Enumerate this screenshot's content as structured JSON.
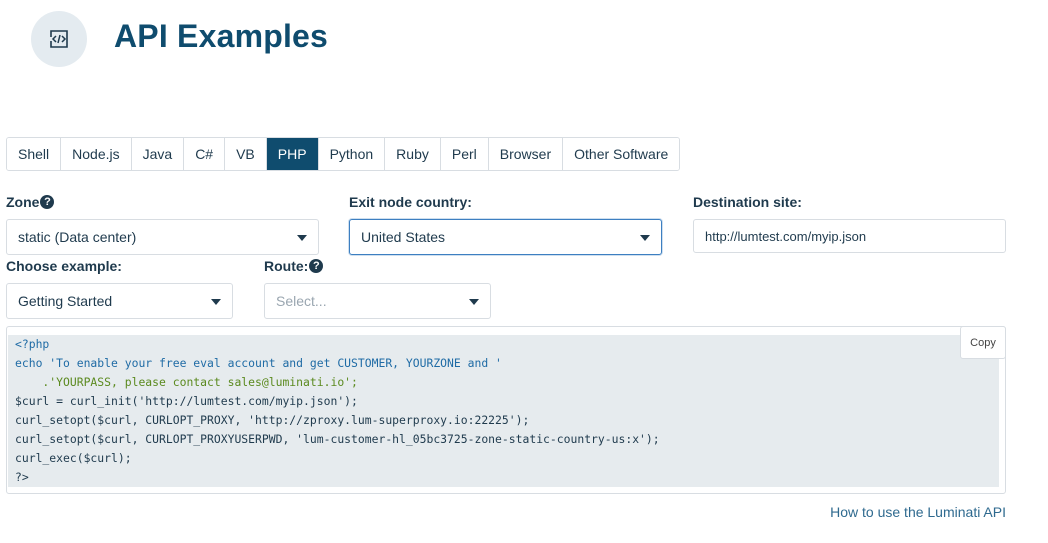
{
  "header": {
    "title": "API Examples",
    "icon": "code-tag-icon"
  },
  "tabs": [
    {
      "label": "Shell",
      "active": false
    },
    {
      "label": "Node.js",
      "active": false
    },
    {
      "label": "Java",
      "active": false
    },
    {
      "label": "C#",
      "active": false
    },
    {
      "label": "VB",
      "active": false
    },
    {
      "label": "PHP",
      "active": true
    },
    {
      "label": "Python",
      "active": false
    },
    {
      "label": "Ruby",
      "active": false
    },
    {
      "label": "Perl",
      "active": false
    },
    {
      "label": "Browser",
      "active": false
    },
    {
      "label": "Other Software",
      "active": false
    }
  ],
  "form": {
    "zone_label": "Zone",
    "zone_value": "static (Data center)",
    "country_label": "Exit node country:",
    "country_value": "United States",
    "destination_label": "Destination site:",
    "destination_value": "http://lumtest.com/myip.json",
    "example_label": "Choose example:",
    "example_value": "Getting Started",
    "route_label": "Route:",
    "route_placeholder": "Select..."
  },
  "code": {
    "lines": [
      "<?php",
      "echo 'To enable your free eval account and get CUSTOMER, YOURZONE and '",
      "    .'YOURPASS, please contact sales@luminati.io';",
      "$curl = curl_init('http://lumtest.com/myip.json');",
      "curl_setopt($curl, CURLOPT_PROXY, 'http://zproxy.lum-superproxy.io:22225');",
      "curl_setopt($curl, CURLOPT_PROXYUSERPWD, 'lum-customer-hl_05bc3725-zone-static-country-us:x');",
      "curl_exec($curl);",
      "?>"
    ],
    "copy_label": "Copy"
  },
  "footer": {
    "link": "How to use the Luminati API"
  },
  "colors": {
    "brand": "#0f4c6e",
    "focus_border": "#3d7fc1",
    "code_bg": "#e6ebee"
  }
}
